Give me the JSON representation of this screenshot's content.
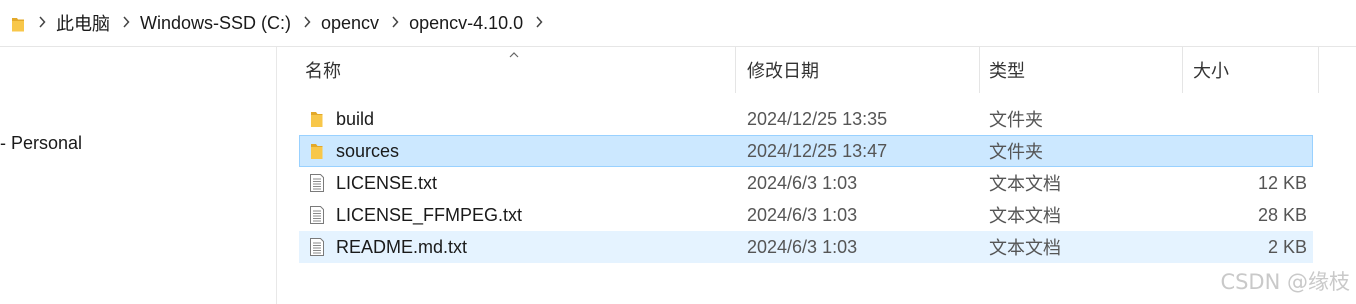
{
  "breadcrumb": {
    "items": [
      "此电脑",
      "Windows-SSD (C:)",
      "opencv",
      "opencv-4.10.0"
    ],
    "separator": ">"
  },
  "nav": {
    "item": "- Personal"
  },
  "columns": {
    "name": "名称",
    "date": "修改日期",
    "type": "类型",
    "size": "大小"
  },
  "files": [
    {
      "name": "build",
      "date": "2024/12/25 13:35",
      "type": "文件夹",
      "size": "",
      "icon": "folder-icon"
    },
    {
      "name": "sources",
      "date": "2024/12/25 13:47",
      "type": "文件夹",
      "size": "",
      "icon": "folder-icon"
    },
    {
      "name": "LICENSE.txt",
      "date": "2024/6/3 1:03",
      "type": "文本文档",
      "size": "12 KB",
      "icon": "text-file-icon"
    },
    {
      "name": "LICENSE_FFMPEG.txt",
      "date": "2024/6/3 1:03",
      "type": "文本文档",
      "size": "28 KB",
      "icon": "text-file-icon"
    },
    {
      "name": "README.md.txt",
      "date": "2024/6/3 1:03",
      "type": "文本文档",
      "size": "2 KB",
      "icon": "text-file-icon"
    }
  ],
  "watermark": "CSDN @缘枝",
  "colors": {
    "selected_bg": "#cce8ff",
    "hover_bg": "#e5f3ff",
    "folder": "#f8c74a"
  }
}
